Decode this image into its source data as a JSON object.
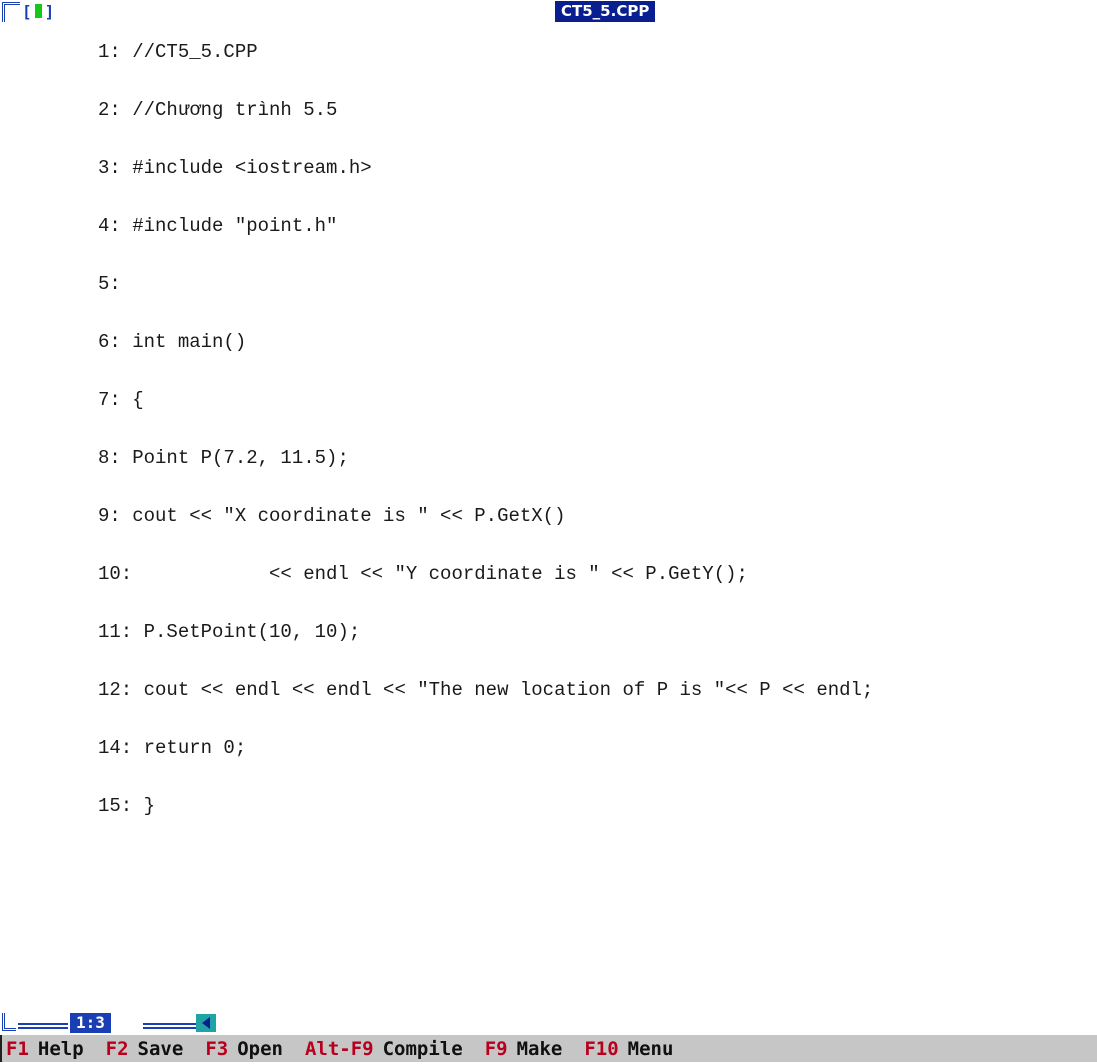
{
  "window": {
    "title": "CT5_5.CPP",
    "close_left_bracket": "[",
    "close_right_bracket": "]"
  },
  "code_lines": [
    "1: //CT5_5.CPP",
    "2: //Chương trình 5.5",
    "3: #include <iostream.h>",
    "4: #include \"point.h\"",
    "5:",
    "6: int main()",
    "7: {",
    "8: Point P(7.2, 11.5);",
    "9: cout << \"X coordinate is \" << P.GetX()",
    "10:            << endl << \"Y coordinate is \" << P.GetY();",
    "11: P.SetPoint(10, 10);",
    "12: cout << endl << endl << \"The new location of P is \"<< P << endl;",
    "14: return 0;",
    "15: }"
  ],
  "status": {
    "cursor_position": "1:3"
  },
  "function_keys": [
    {
      "key": "F1",
      "label": "Help"
    },
    {
      "key": "F2",
      "label": "Save"
    },
    {
      "key": "F3",
      "label": "Open"
    },
    {
      "key": "Alt-F9",
      "label": "Compile"
    },
    {
      "key": "F9",
      "label": "Make"
    },
    {
      "key": "F10",
      "label": "Menu"
    }
  ],
  "colors": {
    "frame": "#1a3fb5",
    "title_bg": "#0a1f8f",
    "close_glyph": "#18c818",
    "fkey_bar_bg": "#c6c6c6",
    "fkey_key": "#b8001e",
    "scroll_arrow_bg": "#1fa3a3"
  }
}
